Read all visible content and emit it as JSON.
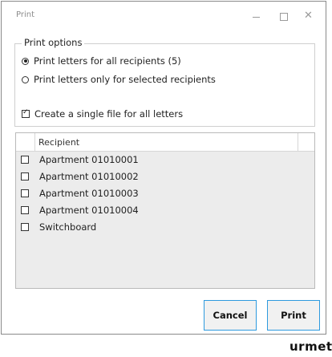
{
  "window": {
    "title": "Print"
  },
  "print_options": {
    "legend": "Print options",
    "option_all": "Print letters for all recipients (5)",
    "option_selected": "Print letters only for selected recipients",
    "selected_option": "all",
    "single_file_label": "Create a single file for all letters",
    "single_file_checked": true
  },
  "recipients": {
    "header": "Recipient",
    "rows": [
      {
        "label": "Apartment 01010001",
        "checked": false
      },
      {
        "label": "Apartment 01010002",
        "checked": false
      },
      {
        "label": "Apartment 01010003",
        "checked": false
      },
      {
        "label": "Apartment 01010004",
        "checked": false
      },
      {
        "label": "Switchboard",
        "checked": false
      }
    ]
  },
  "buttons": {
    "cancel": "Cancel",
    "print": "Print"
  },
  "brand": "urmet",
  "colors": {
    "button_border": "#2d9adf",
    "table_background": "#ececec"
  }
}
